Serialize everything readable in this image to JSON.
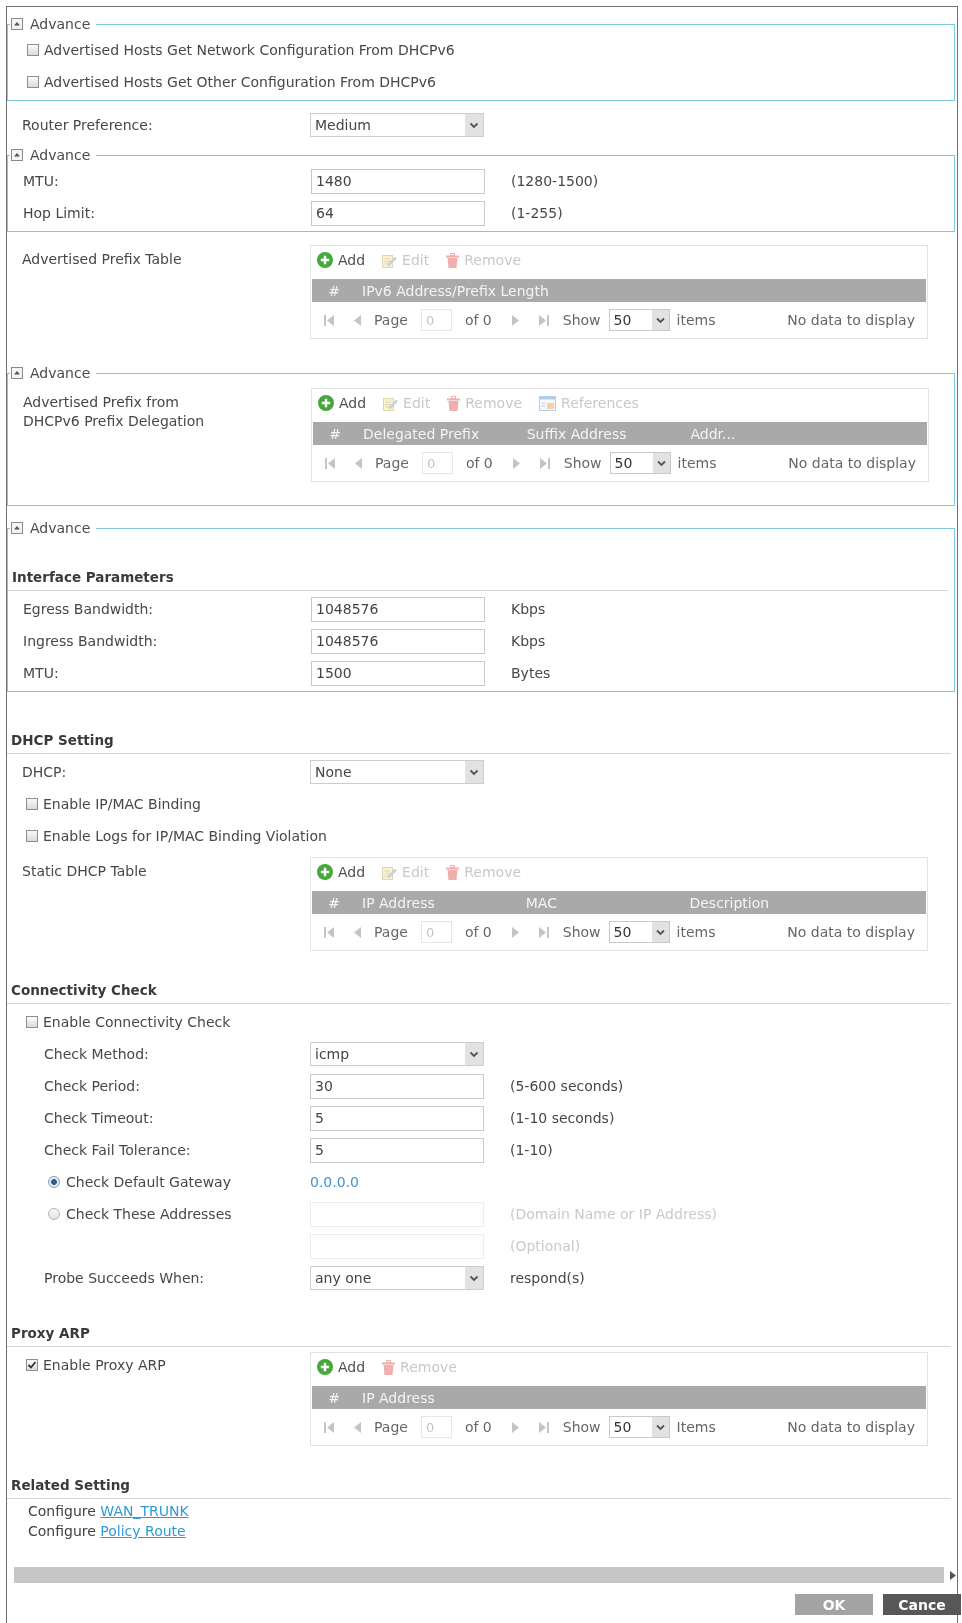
{
  "blocks": [
    {
      "kind": "advance",
      "legend": "Advance",
      "expanded": true,
      "items": [
        {
          "kind": "checkbox",
          "label": "Advertised Hosts Get Network Configuration From DHCPv6",
          "checked": false
        },
        {
          "kind": "checkbox",
          "label": "Advertised Hosts Get Other Configuration From DHCPv6",
          "checked": false
        }
      ]
    },
    {
      "kind": "plain",
      "items": [
        {
          "kind": "select",
          "label": "Router Preference:",
          "value": "Medium"
        }
      ]
    },
    {
      "kind": "advance",
      "legend": "Advance",
      "expanded": true,
      "items": [
        {
          "kind": "input",
          "label": "MTU:",
          "value": "1480",
          "hint": "(1280-1500)",
          "disabled": false
        },
        {
          "kind": "input",
          "label": "Hop Limit:",
          "value": "64",
          "hint": "(1-255)",
          "disabled": false
        }
      ]
    },
    {
      "kind": "plain",
      "items": [
        {
          "kind": "table",
          "label": "Advertised Prefix Table",
          "toolbar": [
            {
              "kind": "add",
              "label": "Add",
              "disabled": false
            },
            {
              "kind": "edit",
              "label": "Edit",
              "disabled": true
            },
            {
              "kind": "remove",
              "label": "Remove",
              "disabled": true
            }
          ],
          "columns": [
            "#",
            "IPv6 Address/Prefix Length"
          ],
          "pager": {
            "disabled": true,
            "page_label": "Page",
            "page": "0",
            "total": "of 0",
            "show_label": "Show",
            "page_size": "50",
            "items_label": "items",
            "message": "No data to display"
          }
        }
      ]
    },
    {
      "kind": "advance",
      "legend": "Advance",
      "expanded": true,
      "items": [
        {
          "kind": "table",
          "label": "Advertised Prefix from DHCPv6 Prefix Delegation",
          "toolbar": [
            {
              "kind": "add",
              "label": "Add",
              "disabled": false
            },
            {
              "kind": "edit",
              "label": "Edit",
              "disabled": true
            },
            {
              "kind": "remove",
              "label": "Remove",
              "disabled": true
            },
            {
              "kind": "references",
              "label": "References",
              "disabled": true
            }
          ],
          "columns": [
            "#",
            "Delegated Prefix",
            "Suffix Address",
            "Addr..."
          ],
          "pager": {
            "disabled": true,
            "page_label": "Page",
            "page": "0",
            "total": "of 0",
            "show_label": "Show",
            "page_size": "50",
            "items_label": "items",
            "message": "No data to display"
          }
        }
      ]
    },
    {
      "kind": "advance",
      "legend": "Advance",
      "expanded": true,
      "items": [
        {
          "kind": "heading",
          "title": "Interface Parameters"
        },
        {
          "kind": "input",
          "label": "Egress Bandwidth:",
          "value": "1048576",
          "hint": "Kbps",
          "disabled": false
        },
        {
          "kind": "input",
          "label": "Ingress Bandwidth:",
          "value": "1048576",
          "hint": "Kbps",
          "disabled": false
        },
        {
          "kind": "input",
          "label": "MTU:",
          "value": "1500",
          "hint": "Bytes",
          "disabled": false
        }
      ]
    },
    {
      "kind": "section",
      "title": "DHCP Setting",
      "items": [
        {
          "kind": "select",
          "label": "DHCP:",
          "value": "None"
        },
        {
          "kind": "checkbox",
          "label": "Enable IP/MAC Binding",
          "checked": false
        },
        {
          "kind": "checkbox",
          "label": "Enable Logs for IP/MAC Binding Violation",
          "checked": false
        },
        {
          "kind": "table",
          "label": "Static DHCP Table",
          "toolbar": [
            {
              "kind": "add",
              "label": "Add",
              "disabled": false
            },
            {
              "kind": "edit",
              "label": "Edit",
              "disabled": true
            },
            {
              "kind": "remove",
              "label": "Remove",
              "disabled": true
            }
          ],
          "columns": [
            "#",
            "IP Address",
            "MAC",
            "Description"
          ],
          "pager": {
            "disabled": true,
            "page_label": "Page",
            "page": "0",
            "total": "of 0",
            "show_label": "Show",
            "page_size": "50",
            "items_label": "items",
            "message": "No data to display"
          }
        }
      ]
    },
    {
      "kind": "section",
      "title": "Connectivity Check",
      "items": [
        {
          "kind": "checkbox",
          "label": "Enable Connectivity Check",
          "checked": false,
          "children": [
            {
              "kind": "select",
              "label": "Check Method:",
              "value": "icmp"
            },
            {
              "kind": "input",
              "label": "Check Period:",
              "value": "30",
              "hint": "(5-600 seconds)",
              "disabled": false
            },
            {
              "kind": "input",
              "label": "Check Timeout:",
              "value": "5",
              "hint": "(1-10 seconds)",
              "disabled": false
            },
            {
              "kind": "input",
              "label": "Check Fail Tolerance:",
              "value": "5",
              "hint": "(1-10)",
              "disabled": false
            },
            {
              "kind": "radio",
              "label": "Check Default Gateway",
              "selected": true,
              "value": "0.0.0.0"
            },
            {
              "kind": "radio",
              "label": "Check These Addresses",
              "selected": false,
              "field": {
                "disabled": true,
                "hint": "(Domain Name or IP Address)"
              }
            },
            {
              "kind": "input",
              "hint": "(Optional)",
              "disabled": true
            },
            {
              "kind": "select",
              "label": "Probe Succeeds When:",
              "value": "any one",
              "hint": "respond(s)"
            }
          ]
        }
      ]
    },
    {
      "kind": "section",
      "title": "Proxy ARP",
      "items": [
        {
          "kind": "table",
          "toggle": {
            "label": "Enable Proxy ARP",
            "checked": true
          },
          "toolbar": [
            {
              "kind": "add",
              "label": "Add",
              "disabled": false
            },
            {
              "kind": "remove",
              "label": "Remove",
              "disabled": true
            }
          ],
          "columns": [
            "#",
            "IP Address"
          ],
          "pager": {
            "disabled": true,
            "page_label": "Page",
            "page": "0",
            "total": "of 0",
            "show_label": "Show",
            "page_size": "50",
            "items_label": "Items",
            "message": "No data to display"
          }
        }
      ]
    },
    {
      "kind": "section",
      "title": "Related Setting",
      "items": [
        {
          "kind": "link",
          "prefix": "Configure",
          "link": "WAN_TRUNK"
        },
        {
          "kind": "link",
          "prefix": "Configure",
          "link": "Policy Route"
        }
      ]
    }
  ],
  "footer": {
    "buttons": [
      {
        "label": "OK",
        "disabled": true
      },
      {
        "label": "Cance",
        "disabled": false
      }
    ]
  }
}
